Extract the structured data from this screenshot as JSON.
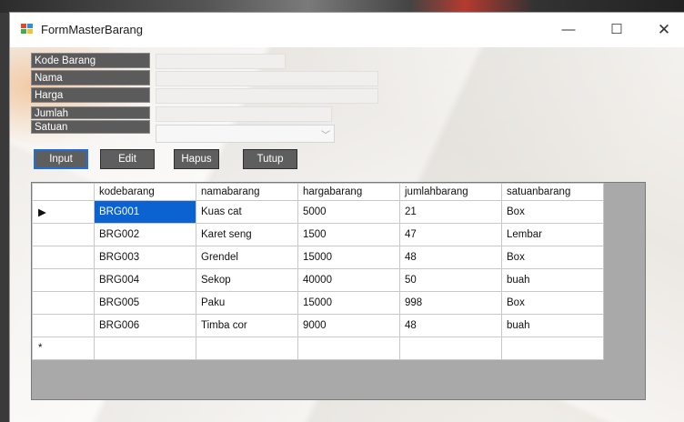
{
  "window": {
    "title": "FormMasterBarang",
    "controls": {
      "minimize": "—",
      "maximize": "☐",
      "close": "✕"
    }
  },
  "form": {
    "labels": [
      "Kode Barang",
      "Nama",
      "Harga",
      "Jumlah",
      "Satuan"
    ],
    "fields": {
      "kode": "",
      "nama": "",
      "harga": "",
      "jumlah": "",
      "satuan": ""
    },
    "combo_arrow": "﹀"
  },
  "buttons": {
    "input": "Input",
    "edit": "Edit",
    "hapus": "Hapus",
    "tutup": "Tutup"
  },
  "grid": {
    "columns": [
      "kodebarang",
      "namabarang",
      "hargabarang",
      "jumlahbarang",
      "satuanbarang"
    ],
    "rows": [
      {
        "indicator": "▶",
        "cells": [
          "BRG001",
          "Kuas cat",
          "5000",
          "21",
          "Box"
        ]
      },
      {
        "indicator": "",
        "cells": [
          "BRG002",
          "Karet seng",
          "1500",
          "47",
          "Lembar"
        ]
      },
      {
        "indicator": "",
        "cells": [
          "BRG003",
          "Grendel",
          "15000",
          "48",
          "Box"
        ]
      },
      {
        "indicator": "",
        "cells": [
          "BRG004",
          "Sekop",
          "40000",
          "50",
          "buah"
        ]
      },
      {
        "indicator": "",
        "cells": [
          "BRG005",
          "Paku",
          "15000",
          "998",
          "Box"
        ]
      },
      {
        "indicator": "",
        "cells": [
          "BRG006",
          "Timba cor",
          "9000",
          "48",
          "buah"
        ]
      }
    ],
    "new_row_indicator": "*"
  },
  "colors": {
    "selection": "#0a63d1",
    "label_bg": "#5b5b5b",
    "button_bg": "#5e5e5e",
    "focus": "#1e6fd9"
  }
}
